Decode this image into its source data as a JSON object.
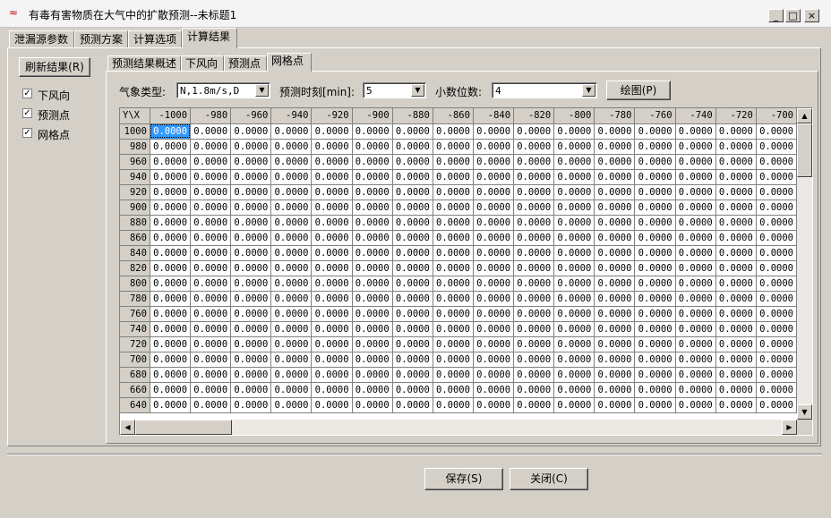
{
  "window": {
    "title": "有毒有害物质在大气中的扩散预测--未标题1",
    "min_label": "_",
    "max_label": "□",
    "close_label": "×"
  },
  "main_tabs": [
    {
      "label": "泄漏源参数"
    },
    {
      "label": "预测方案"
    },
    {
      "label": "计算选项"
    },
    {
      "label": "计算结果"
    }
  ],
  "left_panel": {
    "refresh_label": "刷新结果(R)",
    "checkboxes": [
      {
        "label": "下风向",
        "checked": true
      },
      {
        "label": "预测点",
        "checked": true
      },
      {
        "label": "网格点",
        "checked": true
      }
    ]
  },
  "sub_tabs": [
    {
      "label": "预测结果概述"
    },
    {
      "label": "下风向"
    },
    {
      "label": "预测点"
    },
    {
      "label": "网格点"
    }
  ],
  "controls": {
    "weather_label": "气象类型:",
    "weather_value": "N,1.8m/s,D",
    "time_label": "预测时刻[min]:",
    "time_value": "5",
    "decimal_label": "小数位数:",
    "decimal_value": "4",
    "plot_label": "绘图(P)"
  },
  "grid": {
    "corner": "Y\\X",
    "columns": [
      "-1000",
      "-980",
      "-960",
      "-940",
      "-920",
      "-900",
      "-880",
      "-860",
      "-840",
      "-820",
      "-800",
      "-780",
      "-760",
      "-740",
      "-720",
      "-700"
    ],
    "rows": [
      "1000",
      "980",
      "960",
      "940",
      "920",
      "900",
      "880",
      "860",
      "840",
      "820",
      "800",
      "780",
      "760",
      "740",
      "720",
      "700",
      "680",
      "660",
      "640"
    ],
    "cell_value": "0.0000"
  },
  "footer": {
    "save_label": "保存(S)",
    "close_label": "关闭(C)"
  }
}
